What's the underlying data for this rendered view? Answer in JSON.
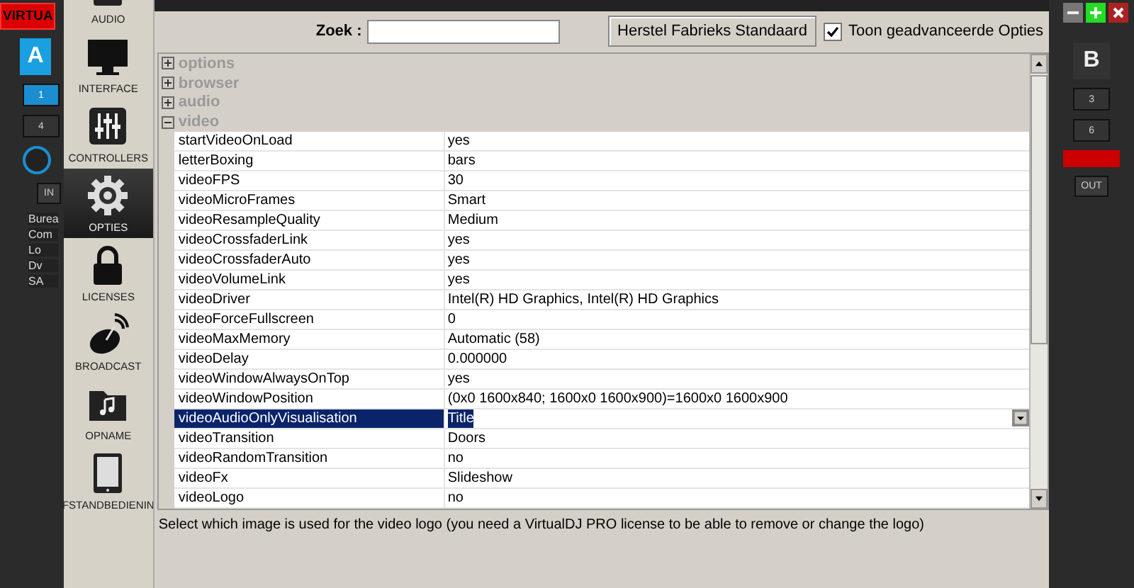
{
  "background_app": {
    "logo": "VIRTUA",
    "left_deck": {
      "deck": "A",
      "pads": [
        {
          "label": "1",
          "selected": true
        },
        {
          "label": "4",
          "selected": false
        }
      ],
      "transport": "IN",
      "tree": [
        "Burea",
        "Com",
        "Lo",
        "Dv",
        "SA"
      ]
    },
    "right_deck": {
      "deck": "B",
      "pads": [
        {
          "label": "3",
          "selected": false
        },
        {
          "label": "6",
          "selected": false
        }
      ],
      "transport": "OUT"
    }
  },
  "sidebar": {
    "items": [
      {
        "label": "AUDIO",
        "selected": false
      },
      {
        "label": "INTERFACE",
        "selected": false
      },
      {
        "label": "CONTROLLERS",
        "selected": false
      },
      {
        "label": "OPTIES",
        "selected": true
      },
      {
        "label": "LICENSES",
        "selected": false
      },
      {
        "label": "BROADCAST",
        "selected": false
      },
      {
        "label": "OPNAME",
        "selected": false
      },
      {
        "label": "FSTANDBEDIENIN",
        "selected": false
      }
    ]
  },
  "search": {
    "label": "Zoek :"
  },
  "reset_button": "Herstel Fabrieks Standaard",
  "advanced_checkbox": {
    "label": "Toon geadvanceerde Opties",
    "checked": true
  },
  "groups": [
    {
      "name": "options",
      "expanded": false
    },
    {
      "name": "browser",
      "expanded": false
    },
    {
      "name": "audio",
      "expanded": false
    },
    {
      "name": "video",
      "expanded": true,
      "children": [
        {
          "name": "startVideoOnLoad",
          "value": "yes",
          "selected": false
        },
        {
          "name": "letterBoxing",
          "value": "bars",
          "selected": false
        },
        {
          "name": "videoFPS",
          "value": "30",
          "selected": false
        },
        {
          "name": "videoMicroFrames",
          "value": "Smart",
          "selected": false
        },
        {
          "name": "videoResampleQuality",
          "value": "Medium",
          "selected": false
        },
        {
          "name": "videoCrossfaderLink",
          "value": "yes",
          "selected": false
        },
        {
          "name": "videoCrossfaderAuto",
          "value": "yes",
          "selected": false
        },
        {
          "name": "videoVolumeLink",
          "value": "yes",
          "selected": false
        },
        {
          "name": "videoDriver",
          "value": "Intel(R) HD Graphics, Intel(R) HD Graphics",
          "selected": false
        },
        {
          "name": "videoForceFullscreen",
          "value": "0",
          "selected": false
        },
        {
          "name": "videoMaxMemory",
          "value": "Automatic (58)",
          "selected": false
        },
        {
          "name": "videoDelay",
          "value": "0.000000",
          "selected": false
        },
        {
          "name": "videoWindowAlwaysOnTop",
          "value": "yes",
          "selected": false
        },
        {
          "name": "videoWindowPosition",
          "value": "(0x0 1600x840; 1600x0 1600x900)=1600x0 1600x900",
          "selected": false
        },
        {
          "name": "videoAudioOnlyVisualisation",
          "value": "Title",
          "selected": true
        },
        {
          "name": "videoTransition",
          "value": "Doors",
          "selected": false
        },
        {
          "name": "videoRandomTransition",
          "value": "no",
          "selected": false
        },
        {
          "name": "videoFx",
          "value": "Slideshow",
          "selected": false
        },
        {
          "name": "videoLogo",
          "value": "no",
          "selected": false
        }
      ]
    }
  ],
  "description": "Select which image is used for the video logo (you need a VirtualDJ PRO license to be able to remove or change the logo)"
}
